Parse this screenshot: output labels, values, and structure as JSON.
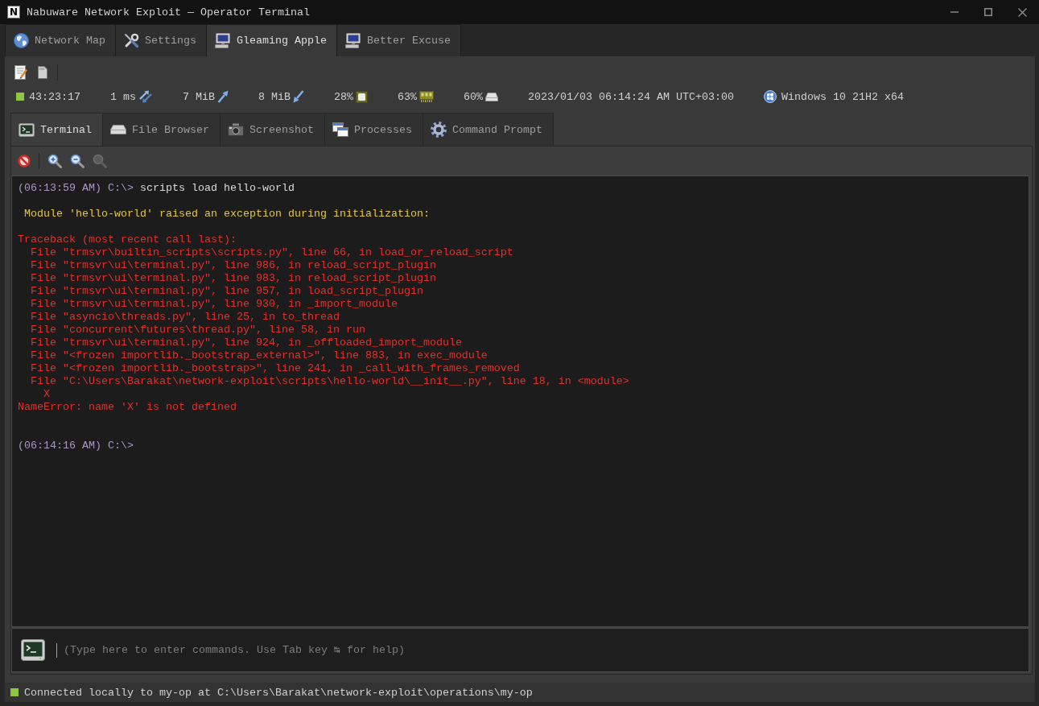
{
  "window": {
    "logo": "N",
    "title": "Nabuware Network Exploit — Operator Terminal"
  },
  "tabs": [
    {
      "label": "Network Map",
      "selected": false
    },
    {
      "label": "Settings",
      "selected": false
    },
    {
      "label": "Gleaming Apple",
      "selected": true
    },
    {
      "label": "Better Excuse",
      "selected": false
    }
  ],
  "stats": [
    "43:23:17",
    "1 ms",
    "7 MiB",
    "8 MiB",
    "28%",
    "63%",
    "60%",
    "2023/01/03 06:14:24 AM UTC+03:00",
    "Windows 10 21H2 x64"
  ],
  "panel_tabs": [
    {
      "label": "Terminal",
      "selected": true
    },
    {
      "label": "File Browser",
      "selected": false
    },
    {
      "label": "Screenshot",
      "selected": false
    },
    {
      "label": "Processes",
      "selected": false
    },
    {
      "label": "Command Prompt",
      "selected": false
    }
  ],
  "terminal_tools": [
    {
      "disabled": false
    },
    {
      "disabled": false
    },
    {
      "disabled": false
    },
    {
      "disabled": true
    }
  ],
  "terminal_output": [
    {
      "kind": "command",
      "prompt": "(06:13:59 AM) C:\\>",
      "command": "scripts load hello-world"
    },
    {
      "kind": "warning",
      "text": "Module 'hello-world' raised an exception during initialization:"
    },
    {
      "kind": "error",
      "lines": [
        "Traceback (most recent call last):",
        "  File \"trmsvr\\builtin_scripts\\scripts.py\", line 66, in load_or_reload_script",
        "  File \"trmsvr\\ui\\terminal.py\", line 986, in reload_script_plugin",
        "  File \"trmsvr\\ui\\terminal.py\", line 983, in reload_script_plugin",
        "  File \"trmsvr\\ui\\terminal.py\", line 957, in load_script_plugin",
        "  File \"trmsvr\\ui\\terminal.py\", line 930, in _import_module",
        "  File \"asyncio\\threads.py\", line 25, in to_thread",
        "  File \"concurrent\\futures\\thread.py\", line 58, in run",
        "  File \"trmsvr\\ui\\terminal.py\", line 924, in _offloaded_import_module",
        "  File \"<frozen importlib._bootstrap_external>\", line 883, in exec_module",
        "  File \"<frozen importlib._bootstrap>\", line 241, in _call_with_frames_removed",
        "  File \"C:\\Users\\Barakat\\network-exploit\\scripts\\hello-world\\__init__.py\", line 18, in <module>",
        "    X",
        "NameError: name 'X' is not defined"
      ]
    },
    {
      "kind": "command",
      "prompt": "(06:14:16 AM) C:\\>"
    }
  ],
  "command_input": {
    "placeholder": "(Type here to enter commands. Use Tab key ↹ for help)"
  },
  "status_bar": {
    "connected": true,
    "text": "Connected locally to my-op at C:\\Users\\Barakat\\network-exploit\\operations\\my-op"
  }
}
